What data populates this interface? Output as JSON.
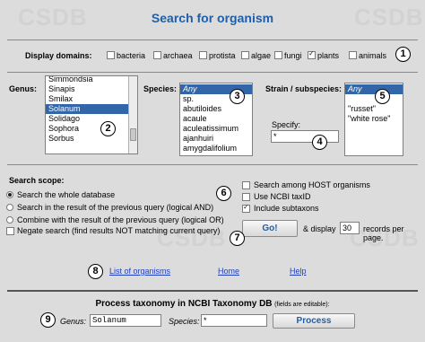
{
  "title": "Search for organism",
  "watermark": "CSDB",
  "domains": {
    "label": "Display domains:",
    "items": [
      {
        "label": "bacteria",
        "checked": false
      },
      {
        "label": "archaea",
        "checked": false
      },
      {
        "label": "protista",
        "checked": false
      },
      {
        "label": "algae",
        "checked": false
      },
      {
        "label": "fungi",
        "checked": false
      },
      {
        "label": "plants",
        "checked": true
      },
      {
        "label": "animals",
        "checked": false
      }
    ]
  },
  "genus": {
    "label": "Genus:",
    "options": [
      "Simmondsia",
      "Sinapis",
      "Smilax",
      "Solanum",
      "Solidago",
      "Sophora",
      "Sorbus"
    ],
    "selected": "Solanum"
  },
  "species": {
    "label": "Species:",
    "options": [
      "Any",
      "sp.",
      "abutiloides",
      "acaule",
      "aculeatissimum",
      "ajanhuiri",
      "amygdalifolium"
    ],
    "selected": "Any"
  },
  "strain": {
    "label": "Strain / subspecies:",
    "options": [
      "Any",
      "",
      "\"russet\"",
      "\"white rose\""
    ],
    "selected": "Any",
    "specify_label": "Specify:",
    "specify_value": "*"
  },
  "scope": {
    "label": "Search scope:",
    "options": [
      {
        "label": "Search the whole database",
        "checked": true
      },
      {
        "label": "Search in the result of the previous query (logical AND)",
        "checked": false
      },
      {
        "label": "Combine with the result of the previous query (logical OR)",
        "checked": false
      }
    ],
    "negate": {
      "label": "Negate search (find results NOT matching current query)",
      "checked": false
    }
  },
  "options": [
    {
      "label": "Search among HOST organisms",
      "checked": false
    },
    {
      "label": "Use NCBI taxID",
      "checked": false
    },
    {
      "label": "Include subtaxons",
      "checked": true
    }
  ],
  "go": {
    "button": "Go!",
    "display_prefix": "& display",
    "display_value": "30",
    "display_suffix": "records per page."
  },
  "links": {
    "list": "List of organisms",
    "home": "Home",
    "help": "Help"
  },
  "ncbi": {
    "title": "Process taxonomy in NCBI Taxonomy DB",
    "note": "(fields are editable):",
    "genus_label": "Genus:",
    "genus_value": "Solanum",
    "species_label": "Species:",
    "species_value": "*",
    "button": "Process"
  },
  "badges": [
    "1",
    "2",
    "3",
    "4",
    "5",
    "6",
    "7",
    "8",
    "9"
  ]
}
